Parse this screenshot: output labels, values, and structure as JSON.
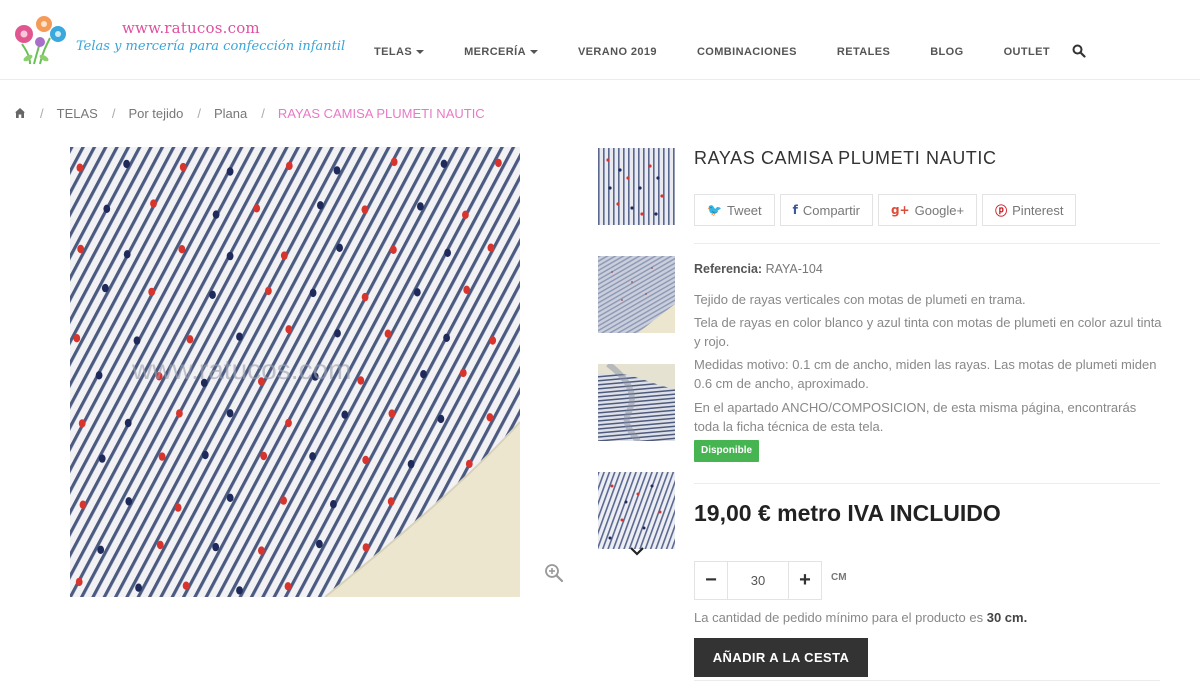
{
  "header": {
    "logo_url_text": "www.ratucos.com",
    "logo_tagline": "Telas y mercería para confección infantil",
    "nav": [
      {
        "label": "TELAS",
        "dropdown": true
      },
      {
        "label": "MERCERÍA",
        "dropdown": true
      },
      {
        "label": "VERANO 2019",
        "dropdown": false
      },
      {
        "label": "COMBINACIONES",
        "dropdown": false
      },
      {
        "label": "RETALES",
        "dropdown": false
      },
      {
        "label": "BLOG",
        "dropdown": false
      },
      {
        "label": "OUTLET",
        "dropdown": false
      }
    ],
    "search_icon": "search-icon"
  },
  "breadcrumb": {
    "home_icon": "home-icon",
    "separator": "/",
    "items": [
      "TELAS",
      "Por tejido",
      "Plana"
    ],
    "current": "RAYAS CAMISA PLUMETI NAUTIC"
  },
  "gallery": {
    "watermark": "www.ratucos.com",
    "zoom_icon": "zoom-in-icon",
    "thumbnails_count": 4,
    "scroll_down_icon": "chevron-down-icon"
  },
  "product": {
    "title": "RAYAS CAMISA PLUMETI NAUTIC",
    "share": {
      "tweet": "Tweet",
      "facebook": "Compartir",
      "google": "Google+",
      "pinterest": "Pinterest"
    },
    "reference_label": "Referencia:",
    "reference_value": "RAYA-104",
    "description": [
      "Tejido de rayas verticales con motas de plumeti en trama.",
      "Tela de rayas en color blanco y azul tinta con motas de plumeti en color azul tinta y rojo.",
      "Medidas motivo: 0.1 cm de ancho, miden las rayas. Las motas de plumeti miden 0.6 cm de ancho, aproximado.",
      "En el apartado ANCHO/COMPOSICION, de esta misma página, encontrarás toda la ficha técnica de esta tela."
    ],
    "availability": "Disponible",
    "price": "19,00 € metro IVA INCLUIDO",
    "quantity": "30",
    "quantity_unit": "CM",
    "minus_label": "−",
    "plus_label": "+",
    "min_order_text": "La cantidad de pedido mínimo para el producto es",
    "min_order_value": "30 cm.",
    "add_to_cart": "AÑADIR A LA CESTA"
  },
  "colors": {
    "accent_pink": "#e879c7",
    "available_green": "#46b450",
    "button_dark": "#333333",
    "stripe_blue": "#3b4a72",
    "dot_red": "#d8342e",
    "dot_navy": "#1f2a5c"
  }
}
